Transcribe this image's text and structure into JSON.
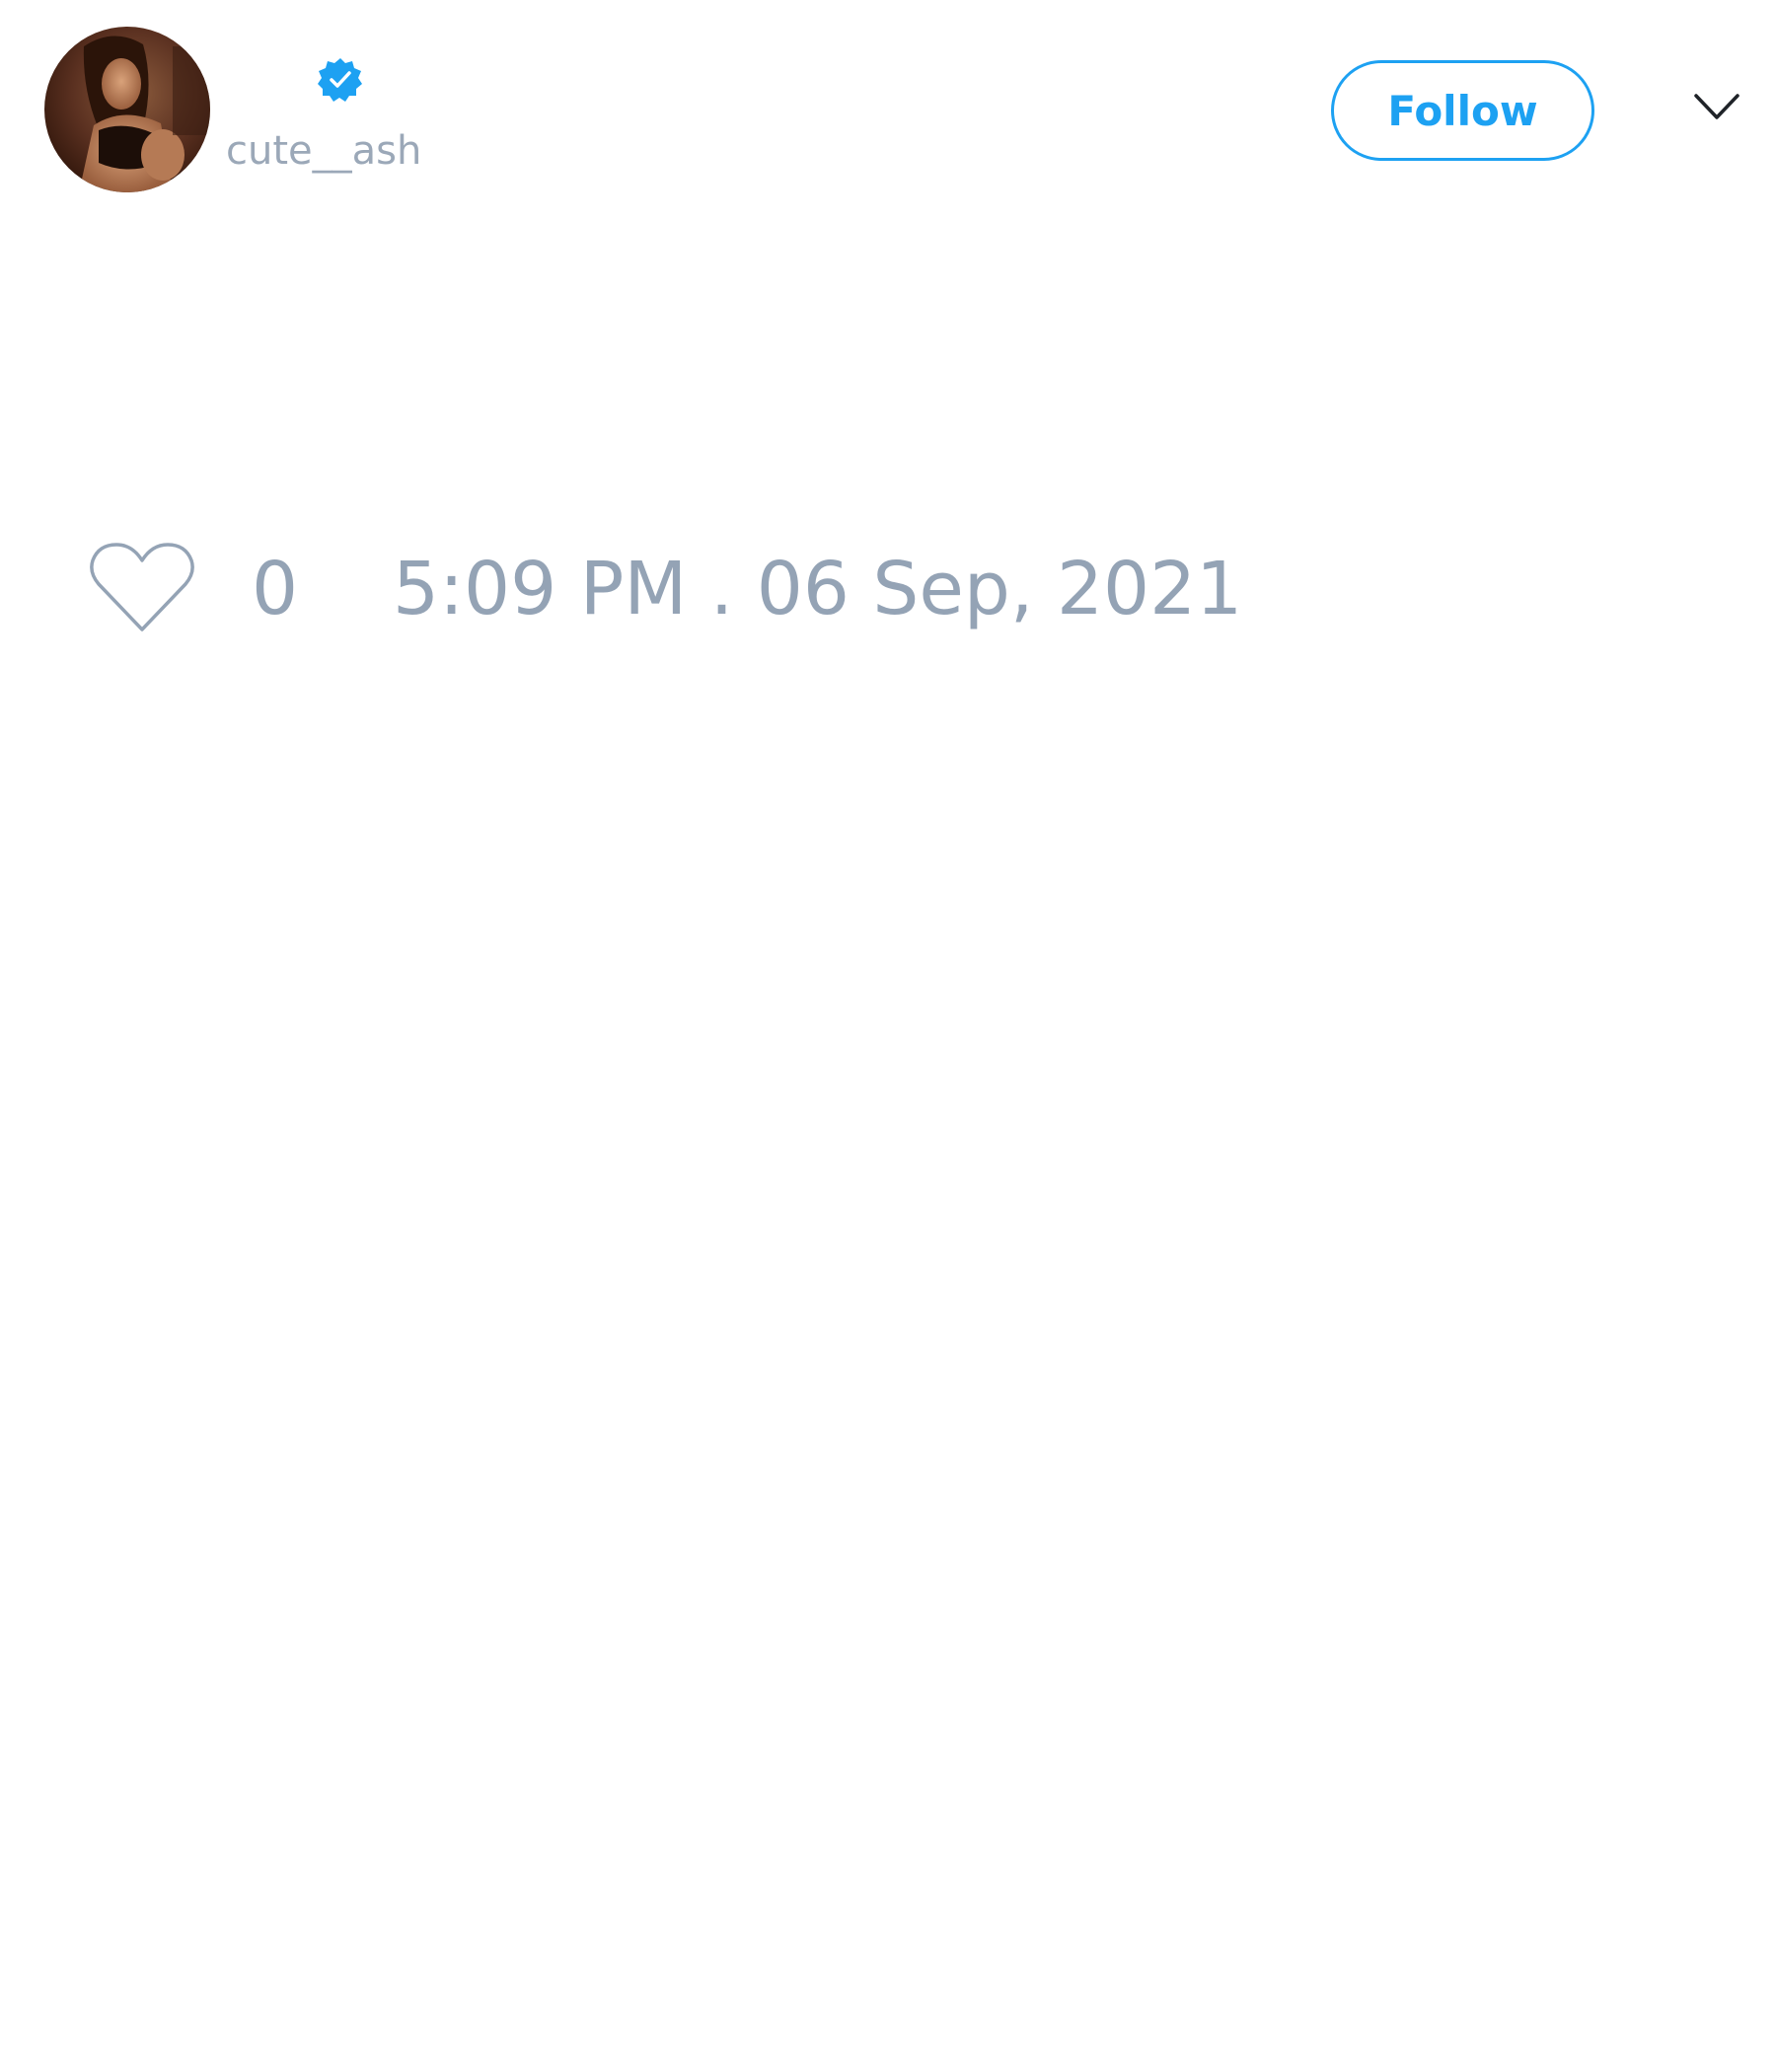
{
  "author": {
    "display_name": "",
    "username": "cute__ash",
    "verified": true,
    "avatar_icon": "profile-photo"
  },
  "header": {
    "follow_label": "Follow",
    "menu_icon": "chevron-down-icon"
  },
  "tweet": {
    "like_icon": "heart-outline-icon",
    "like_count": "0",
    "timestamp": "5:09 PM . 06 Sep, 2021"
  },
  "colors": {
    "accent": "#1da1f2",
    "muted_text": "#94a3b5",
    "background": "#ffffff"
  }
}
